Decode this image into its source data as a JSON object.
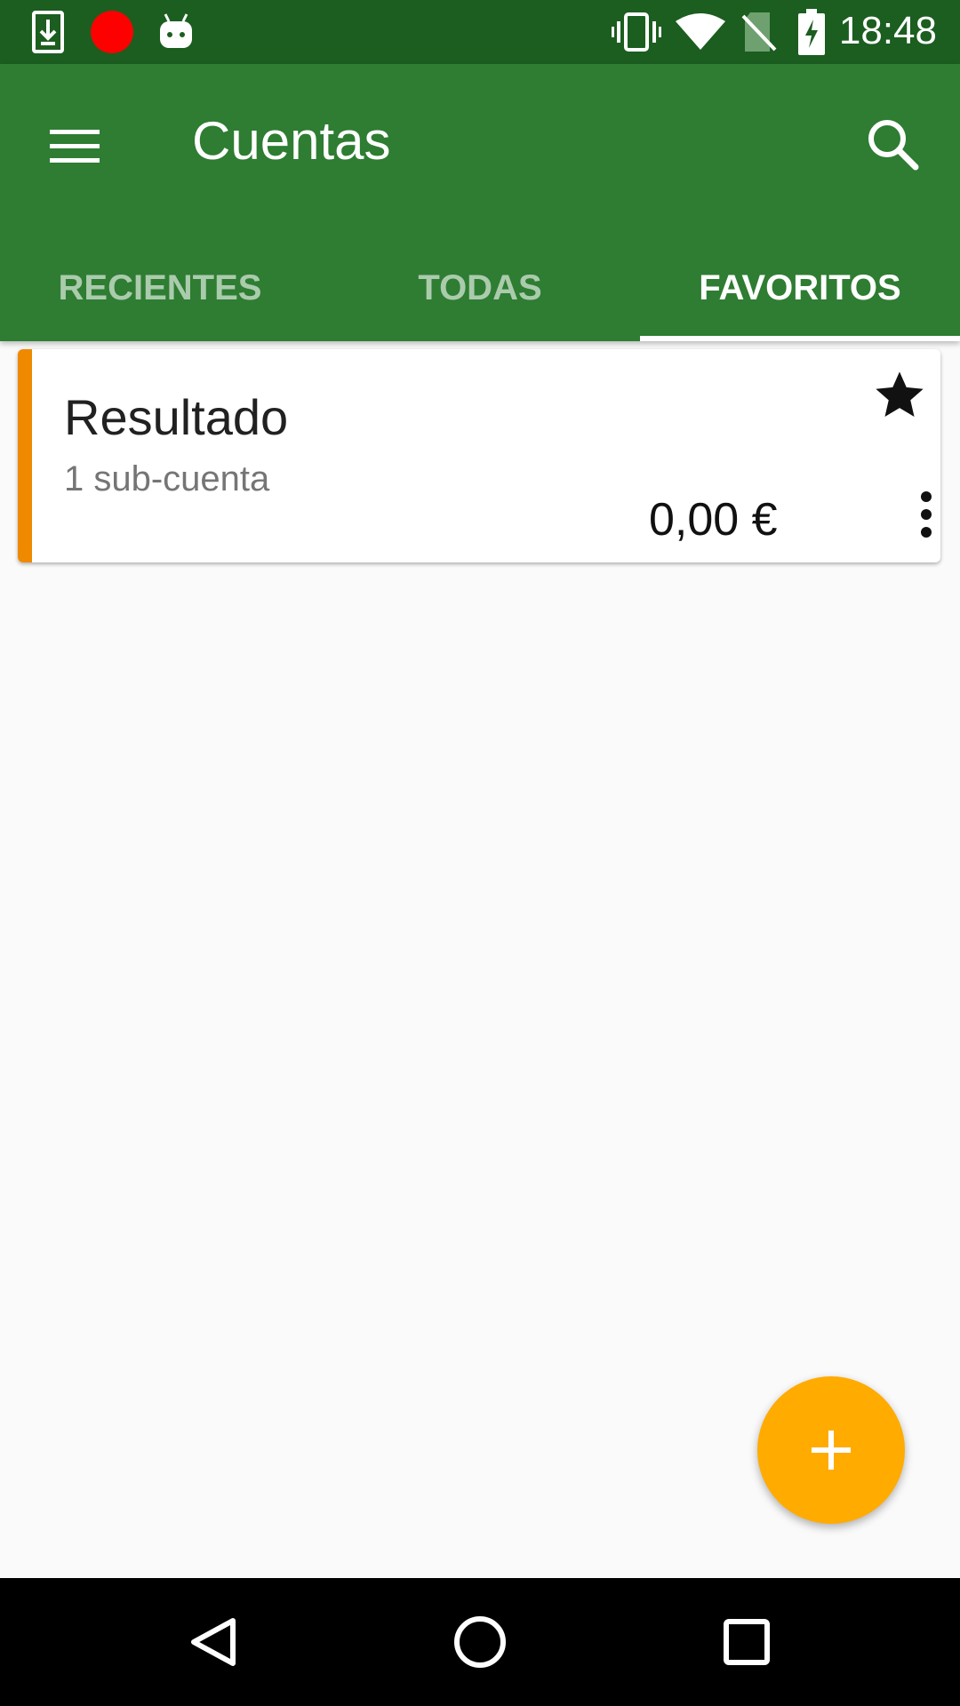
{
  "status_bar": {
    "time": "18:48",
    "left_icons": [
      "download-icon",
      "record-dot-icon",
      "android-icon"
    ],
    "right_icons": [
      "vibrate-icon",
      "wifi-icon",
      "no-sim-icon",
      "battery-charging-icon"
    ]
  },
  "app_bar": {
    "title": "Cuentas",
    "color": "#2e7d32",
    "status_color": "#1b5e20"
  },
  "tabs": [
    {
      "label": "RECIENTES",
      "active": false
    },
    {
      "label": "TODAS",
      "active": false
    },
    {
      "label": "FAVORITOS",
      "active": true
    }
  ],
  "accounts": [
    {
      "name": "Resultado",
      "subaccounts": "1 sub-cuenta",
      "balance": "0,00 €",
      "favorite": true,
      "stripe_color": "#ef8a00"
    }
  ],
  "fab": {
    "icon": "plus-icon",
    "color": "#ffab00"
  },
  "nav_bar": [
    "back-icon",
    "home-icon",
    "recents-icon"
  ]
}
